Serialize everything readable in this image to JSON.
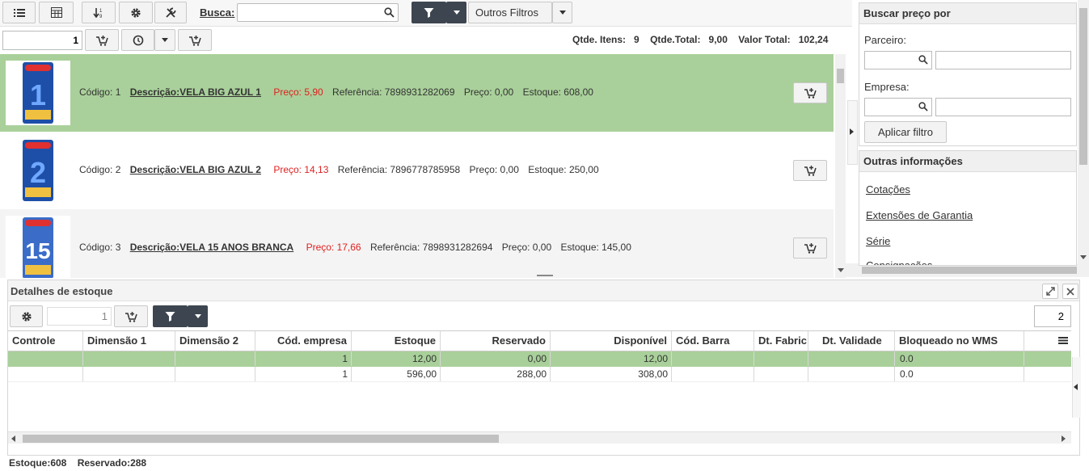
{
  "toolbar": {
    "search_label": "Busca:",
    "search_value": "",
    "other_filters": "Outros Filtros",
    "qty_value": "1",
    "qtde_itens_label": "Qtde. Itens:",
    "qtde_itens": "9",
    "qtde_total_label": "Qtde.Total:",
    "qtde_total": "9,00",
    "valor_total_label": "Valor Total:",
    "valor_total": "102,24"
  },
  "products": [
    {
      "codigo": "Código: 1",
      "descricao": "Descrição:VELA BIG AZUL 1",
      "preco": "Preço: 5,90",
      "referencia": "Referência: 7898931282069",
      "preco2": "Preço: 0,00",
      "estoque": "Estoque: 608,00",
      "thumb": "1"
    },
    {
      "codigo": "Código: 2",
      "descricao": "Descrição:VELA BIG AZUL 2",
      "preco": "Preço: 14,13",
      "referencia": "Referência: 7896778785958",
      "preco2": "Preço: 0,00",
      "estoque": "Estoque: 250,00",
      "thumb": "2"
    },
    {
      "codigo": "Código: 3",
      "descricao": "Descrição:VELA 15 ANOS BRANCA",
      "preco": "Preço: 17,66",
      "referencia": "Referência: 7898931282694",
      "preco2": "Preço: 0,00",
      "estoque": "Estoque: 145,00",
      "thumb": "15"
    }
  ],
  "side": {
    "price_title": "Buscar preço por",
    "parceiro_label": "Parceiro:",
    "empresa_label": "Empresa:",
    "apply_filter": "Aplicar filtro",
    "other_info_title": "Outras informações",
    "links": [
      "Cotações",
      "Extensões de Garantia",
      "Série",
      "Consignações"
    ]
  },
  "stock": {
    "title": "Detalhes de estoque",
    "qty_value": "1",
    "page_value": "2",
    "columns": [
      "Controle",
      "Dimensão 1",
      "Dimensão 2",
      "Cód. empresa",
      "Estoque",
      "Reservado",
      "Disponível",
      "Cód. Barra",
      "Dt. Fabric",
      "Dt. Validade",
      "Bloqueado no WMS"
    ],
    "rows": [
      [
        "",
        "",
        "",
        "1",
        "12,00",
        "0,00",
        "12,00",
        "",
        "",
        "",
        "0.0"
      ],
      [
        "",
        "",
        "",
        "1",
        "596,00",
        "288,00",
        "308,00",
        "",
        "",
        "",
        "0.0"
      ]
    ],
    "footer_estoque": "Estoque:608",
    "footer_reservado": "Reservado:288"
  },
  "colors": {
    "selected_row": "#a9d09a",
    "dark_button": "#3d4550",
    "price": "#e02020",
    "stripe": "#f4f4f4"
  }
}
